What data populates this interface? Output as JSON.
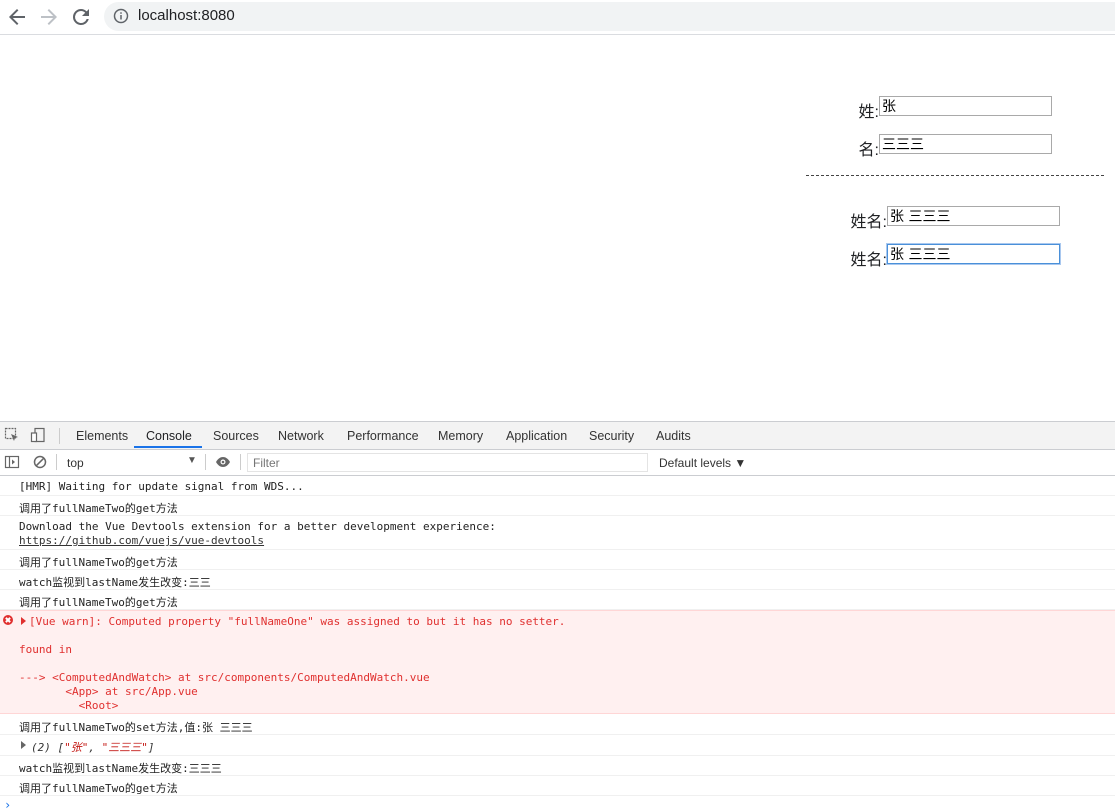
{
  "browser": {
    "url": "localhost:8080",
    "back_icon": "arrow-left-icon",
    "forward_icon": "arrow-right-icon",
    "reload_icon": "reload-icon",
    "info_icon": "info-icon"
  },
  "form": {
    "last_name_label": "姓:",
    "last_name_value": "张",
    "first_name_label": "名:",
    "first_name_value": "三三三",
    "divider": "---------------------------------------------------------------",
    "full_name_one_label": "姓名:",
    "full_name_one_value": "张 三三三",
    "full_name_two_label": "姓名:",
    "full_name_two_value": "张 三三三"
  },
  "devtools": {
    "tabs": [
      "Elements",
      "Console",
      "Sources",
      "Network",
      "Performance",
      "Memory",
      "Application",
      "Security",
      "Audits"
    ],
    "active_tab": "Console",
    "context": "top",
    "filter_placeholder": "Filter",
    "levels": "Default levels ▼",
    "prompt": "›"
  },
  "console": {
    "m1": "[HMR] Waiting for update signal from WDS...",
    "m2": "调用了fullNameTwo的get方法",
    "m3_line1": "Download the Vue Devtools extension for a better development experience:",
    "m3_link": "https://github.com/vuejs/vue-devtools",
    "m4": "调用了fullNameTwo的get方法",
    "m5": "watch监视到lastName发生改变:三三",
    "m6": "调用了fullNameTwo的get方法",
    "err_line1": "[Vue warn]: Computed property \"fullNameOne\" was assigned to but it has no setter.",
    "err_line2": "found in",
    "err_line3": "---> <ComputedAndWatch> at src/components/ComputedAndWatch.vue",
    "err_line4": "       <App> at src/App.vue",
    "err_line5": "         <Root>",
    "m8": "调用了fullNameTwo的set方法,值:张 三三三",
    "m9_prefix": "(2) [",
    "m9_item1": "\"张\"",
    "m9_sep": ", ",
    "m9_item2": "\"三三三\"",
    "m9_suffix": "]",
    "m10": "watch监视到lastName发生改变:三三三",
    "m11": "调用了fullNameTwo的get方法"
  }
}
